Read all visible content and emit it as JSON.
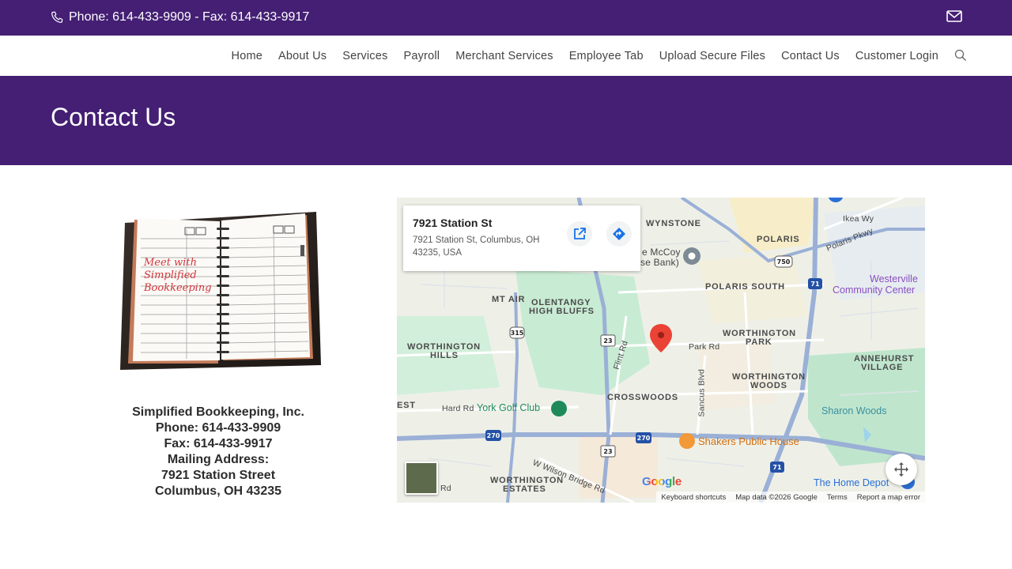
{
  "topbar": {
    "phone_text": "Phone: 614-433-9909 - Fax: 614-433-9917"
  },
  "nav": {
    "items": [
      "Home",
      "About Us",
      "Services",
      "Payroll",
      "Merchant Services",
      "Employee Tab",
      "Upload Secure Files",
      "Contact Us",
      "Customer Login"
    ]
  },
  "page": {
    "title": "Contact Us"
  },
  "planner_image": {
    "caption": "Meet with Simplified Bookkeeping",
    "lines": [
      "Meet with",
      "Simplified",
      "Bookkeeping"
    ]
  },
  "contact": {
    "company": "Simplified Bookkeeping, Inc.",
    "phone": "Phone: 614-433-9909",
    "fax": "Fax: 614-433-9917",
    "mailing_label": "Mailing Address:",
    "street": "7921 Station Street",
    "city": "Columbus, OH 43235"
  },
  "map": {
    "card_title": "7921 Station St",
    "card_address": "7921 Station St, Columbus, OH 43235, USA",
    "labels": {
      "wynstone": "WYNSTONE",
      "polaris": "POLARIS",
      "polaris_south": "POLARIS SOUTH",
      "mt_air": "MT AIR",
      "olentangy": "OLENTANGY",
      "high_bluffs": "HIGH BLUFFS",
      "worthington_hills_1": "WORTHINGTON",
      "worthington_hills_2": "HILLS",
      "worthington_park_1": "WORTHINGTON",
      "worthington_park_2": "PARK",
      "worthington_woods_1": "WORTHINGTON",
      "worthington_woods_2": "WOODS",
      "annehurst_1": "ANNEHURST",
      "annehurst_2": "VILLAGE",
      "crosswoods": "CROSSWOODS",
      "worthington_estates_1": "WORTHINGTON",
      "worthington_estates_2": "ESTATES",
      "est": "EST",
      "mccoy_1": "e McCoy",
      "mccoy_2": "se Bank)",
      "ikea": "Ikea Wy",
      "polaris_pkwy": "Polaris Pkwy",
      "park_rd": "Park Rd",
      "flint_rd": "Flint Rd",
      "sancus": "Sancus Blvd",
      "hard_rd": "Hard Rd",
      "wilson_bridge": "W Wilson Bridge Rd",
      "rd": "Rd",
      "york_golf": "York Golf Club",
      "shakers": "Shakers Public House",
      "westerville_1": "Westerville",
      "westerville_2": "Community Center",
      "sharon_woods": "Sharon Woods",
      "home_depot": "The Home Depot"
    },
    "shields": [
      "315",
      "23",
      "270",
      "270",
      "23",
      "71",
      "71",
      "750"
    ],
    "google": "Google",
    "footer": {
      "shortcuts": "Keyboard shortcuts",
      "data": "Map data ©2026 Google",
      "terms": "Terms",
      "report": "Report a map error"
    }
  }
}
